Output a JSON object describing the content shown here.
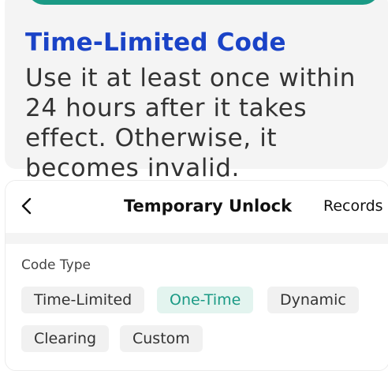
{
  "info_card": {
    "title": "Time-Limited Code",
    "description": "Use it at least once within 24 hours after it takes effect. Otherwise, it becomes invalid."
  },
  "nav": {
    "back_icon": "chevron-left-icon",
    "title": "Temporary Unlock",
    "records_label": "Records"
  },
  "code_type": {
    "label": "Code Type",
    "selected": "One-Time",
    "options": [
      "Time-Limited",
      "One-Time",
      "Dynamic",
      "Clearing",
      "Custom"
    ]
  },
  "colors": {
    "accent": "#1a9a85",
    "title_blue": "#1a43c7"
  }
}
